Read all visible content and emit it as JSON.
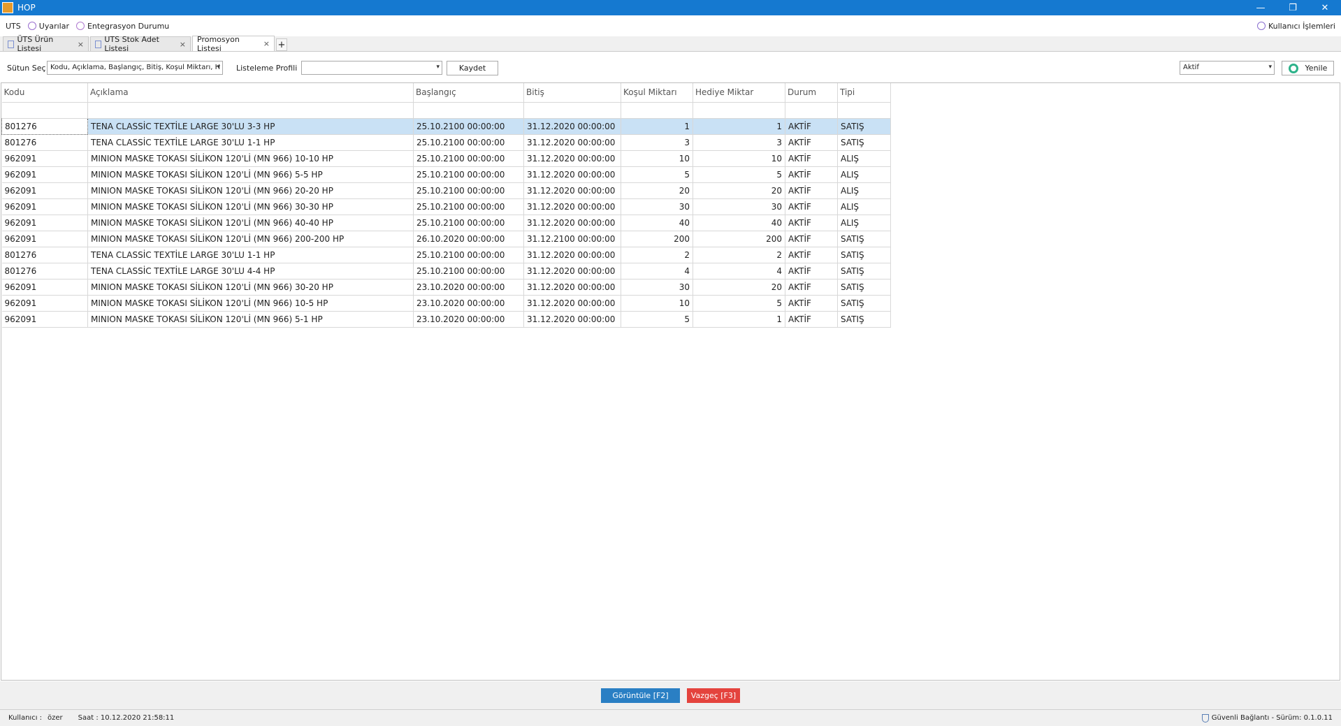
{
  "window": {
    "title": "HOP",
    "minimize": "—",
    "restore": "❐",
    "close": "✕"
  },
  "menu": {
    "items": [
      "UTS",
      "Uyarılar",
      "Entegrasyon Durumu"
    ],
    "user_ops": "Kullanıcı İşlemleri"
  },
  "tabs": [
    {
      "label": "ÜTS Ürün Listesi",
      "close": "×"
    },
    {
      "label": "UTS Stok Adet Listesi",
      "close": "×"
    },
    {
      "label": "Promosyon Listesi",
      "close": "×"
    }
  ],
  "tab_add": "+",
  "toolbar": {
    "column_select_label": "Sütun Seç",
    "column_select_value": "Kodu, Açıklama, Başlangıç, Bitiş, Koşul Miktarı, H",
    "profile_label": "Listeleme Profili",
    "profile_value": "",
    "save_label": "Kaydet",
    "status_value": "Aktif",
    "refresh_label": "Yenile",
    "arrow": "▾"
  },
  "table": {
    "columns": [
      "Kodu",
      "Açıklama",
      "Başlangıç",
      "Bitiş",
      "Koşul Miktarı",
      "Hediye Miktar",
      "Durum",
      "Tipi"
    ],
    "rows": [
      [
        "801276",
        "TENA CLASSİC TEXTİLE LARGE 30'LU 3-3 HP",
        "25.10.2100 00:00:00",
        "31.12.2020 00:00:00",
        "1",
        "1",
        "AKTİF",
        "SATIŞ"
      ],
      [
        "801276",
        "TENA CLASSİC TEXTİLE LARGE 30'LU 1-1 HP",
        "25.10.2100 00:00:00",
        "31.12.2020 00:00:00",
        "3",
        "3",
        "AKTİF",
        "SATIŞ"
      ],
      [
        "962091",
        "MINION MASKE TOKASI SİLİKON 120'Lİ (MN 966) 10-10 HP",
        "25.10.2100 00:00:00",
        "31.12.2020 00:00:00",
        "10",
        "10",
        "AKTİF",
        "ALIŞ"
      ],
      [
        "962091",
        "MINION MASKE TOKASI SİLİKON 120'Lİ (MN 966) 5-5 HP",
        "25.10.2100 00:00:00",
        "31.12.2020 00:00:00",
        "5",
        "5",
        "AKTİF",
        "ALIŞ"
      ],
      [
        "962091",
        "MINION MASKE TOKASI SİLİKON 120'Lİ (MN 966) 20-20 HP",
        "25.10.2100 00:00:00",
        "31.12.2020 00:00:00",
        "20",
        "20",
        "AKTİF",
        "ALIŞ"
      ],
      [
        "962091",
        "MINION MASKE TOKASI SİLİKON 120'Lİ (MN 966) 30-30 HP",
        "25.10.2100 00:00:00",
        "31.12.2020 00:00:00",
        "30",
        "30",
        "AKTİF",
        "ALIŞ"
      ],
      [
        "962091",
        "MINION MASKE TOKASI SİLİKON 120'Lİ (MN 966) 40-40 HP",
        "25.10.2100 00:00:00",
        "31.12.2020 00:00:00",
        "40",
        "40",
        "AKTİF",
        "ALIŞ"
      ],
      [
        "962091",
        "MINION MASKE TOKASI SİLİKON 120'Lİ (MN 966) 200-200 HP",
        "26.10.2020 00:00:00",
        "31.12.2100 00:00:00",
        "200",
        "200",
        "AKTİF",
        "SATIŞ"
      ],
      [
        "801276",
        "TENA CLASSİC TEXTİLE LARGE 30'LU 1-1 HP",
        "25.10.2100 00:00:00",
        "31.12.2020 00:00:00",
        "2",
        "2",
        "AKTİF",
        "SATIŞ"
      ],
      [
        "801276",
        "TENA CLASSİC TEXTİLE LARGE 30'LU 4-4 HP",
        "25.10.2100 00:00:00",
        "31.12.2020 00:00:00",
        "4",
        "4",
        "AKTİF",
        "SATIŞ"
      ],
      [
        "962091",
        "MINION MASKE TOKASI SİLİKON 120'Lİ (MN 966) 30-20 HP",
        "23.10.2020 00:00:00",
        "31.12.2020 00:00:00",
        "30",
        "20",
        "AKTİF",
        "SATIŞ"
      ],
      [
        "962091",
        "MINION MASKE TOKASI SİLİKON 120'Lİ (MN 966) 10-5 HP",
        "23.10.2020 00:00:00",
        "31.12.2020 00:00:00",
        "10",
        "5",
        "AKTİF",
        "SATIŞ"
      ],
      [
        "962091",
        "MINION MASKE TOKASI SİLİKON 120'Lİ (MN 966) 5-1 HP",
        "23.10.2020 00:00:00",
        "31.12.2020 00:00:00",
        "5",
        "1",
        "AKTİF",
        "SATIŞ"
      ]
    ]
  },
  "actions": {
    "view_label": "Görüntüle [F2]",
    "cancel_label": "Vazgeç [F3]"
  },
  "status": {
    "user_label": "Kullanıcı :",
    "user_value": "özer",
    "time": "Saat : 10.12.2020 21:58:11",
    "connection": "Güvenli Bağlantı - Sürüm: 0.1.0.11"
  },
  "colors": {
    "titlebar": "#1579d0",
    "selected_row": "#c9e1f5",
    "view_button": "#2a7fc4",
    "cancel_button": "#e4433d",
    "refresh_icon": "#2db28a"
  }
}
